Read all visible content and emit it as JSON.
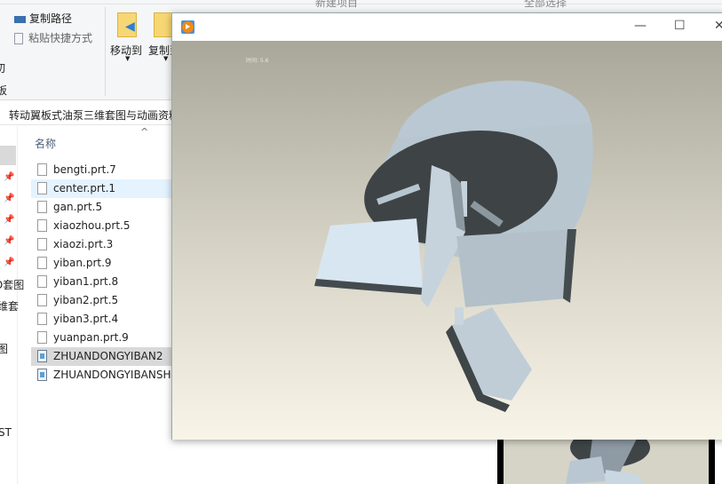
{
  "ribbon": {
    "copy_path": "复制路径",
    "paste_shortcut": "粘贴快捷方式",
    "cut_partial": "切",
    "clipboard_partial": "板",
    "move_to": "移动到",
    "copy_to": "复制到",
    "top_partial_1": "新建项目",
    "top_partial_2": "全部选择"
  },
  "address": {
    "path": "转动翼板式油泵三维套图与动画资料"
  },
  "nav_partial": [
    "D套图",
    "维套",
    "图",
    "ST"
  ],
  "file_list": {
    "column_name": "名称",
    "files": [
      {
        "name": "bengti.prt.7",
        "type": "file"
      },
      {
        "name": "center.prt.1",
        "type": "file",
        "state": "hover"
      },
      {
        "name": "gan.prt.5",
        "type": "file"
      },
      {
        "name": "xiaozhou.prt.5",
        "type": "file"
      },
      {
        "name": "xiaozi.prt.3",
        "type": "file"
      },
      {
        "name": "yiban.prt.9",
        "type": "file"
      },
      {
        "name": "yiban1.prt.8",
        "type": "file"
      },
      {
        "name": "yiban2.prt.5",
        "type": "file"
      },
      {
        "name": "yiban3.prt.4",
        "type": "file"
      },
      {
        "name": "yuanpan.prt.9",
        "type": "file"
      },
      {
        "name": "ZHUANDONGYIBAN2",
        "type": "video",
        "state": "selected"
      },
      {
        "name": "ZHUANDONGYIBANSH",
        "type": "video"
      }
    ]
  },
  "video_window": {
    "app_icon": "media-player-icon",
    "osd_text": "时间: 5.6",
    "minimize": "—",
    "maximize": "☐",
    "close": "✕"
  },
  "colors": {
    "accent": "#f28a12",
    "selection": "#e5f3ff",
    "selected_gray": "#d9d9d9"
  }
}
